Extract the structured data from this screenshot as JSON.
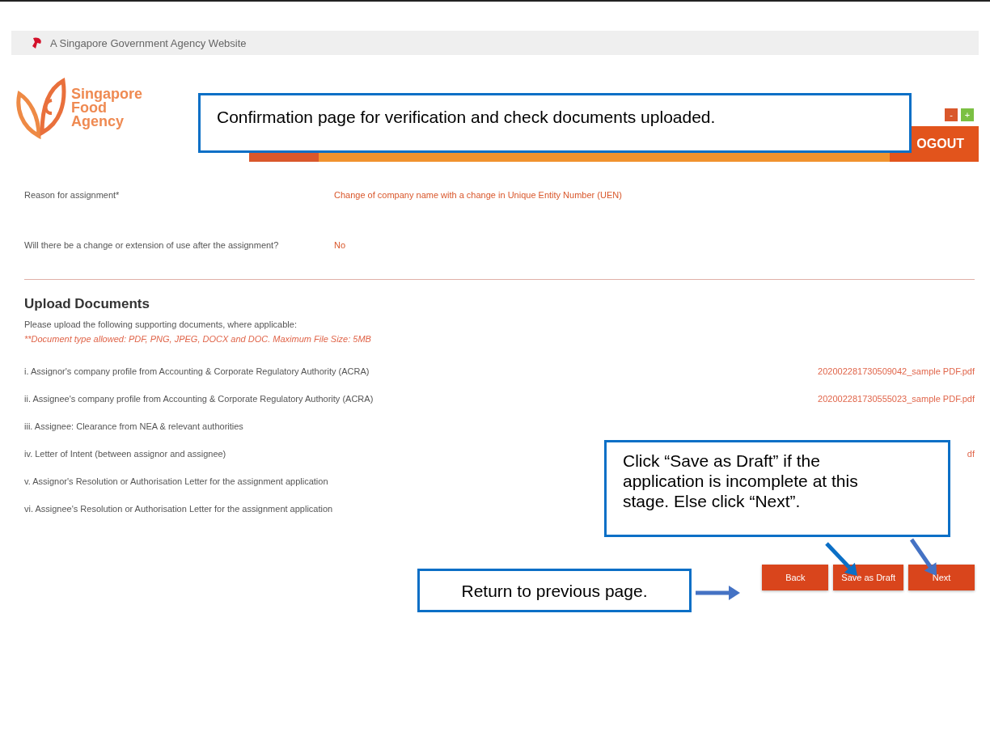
{
  "gov_banner": {
    "text": "A Singapore Government Agency Website"
  },
  "logo": {
    "lines": [
      "Singapore",
      "Food",
      "Agency"
    ]
  },
  "header": {
    "font_buttons": [
      "-",
      "+"
    ],
    "logout": "OGOUT"
  },
  "section": {
    "fields": [
      {
        "label": "Reason for assignment*",
        "value": "Change of company name with a change in Unique Entity Number (UEN)"
      },
      {
        "label": "Will there be a change or extension of use after the assignment?",
        "value": "No"
      }
    ]
  },
  "upload": {
    "title": "Upload Documents",
    "intro": "Please upload the following supporting documents, where applicable:",
    "note": "**Document type allowed: PDF, PNG, JPEG, DOCX and DOC. Maximum File Size: 5MB",
    "documents": [
      {
        "label": "i. Assignor's company profile from Accounting & Corporate Regulatory Authority (ACRA)",
        "file": "202002281730509042_sample PDF.pdf"
      },
      {
        "label": "ii. Assignee's company profile from Accounting & Corporate Regulatory Authority (ACRA)",
        "file": "202002281730555023_sample PDF.pdf"
      },
      {
        "label": "iii. Assignee: Clearance from NEA & relevant authorities"
      },
      {
        "label": "iv. Letter of Intent (between assignor and assignee)",
        "file": "df"
      },
      {
        "label": "v. Assignor's Resolution or Authorisation Letter for the assignment application"
      },
      {
        "label": "vi. Assignee's Resolution or Authorisation Letter for the assignment application"
      }
    ]
  },
  "buttons": [
    "Back",
    "Save as Draft",
    "Next"
  ],
  "callouts": [
    {
      "text": "Confirmation page for verification and check documents uploaded."
    },
    {
      "text": "Click “Save as Draft” if the application is incomplete at this stage. Else click “Next”."
    },
    {
      "text": "Return to previous page."
    }
  ]
}
